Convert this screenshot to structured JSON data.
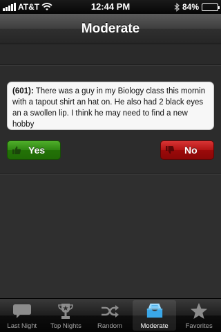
{
  "status_bar": {
    "carrier": "AT&T",
    "time": "12:44 PM",
    "battery": "84%",
    "battery_level": 0.84
  },
  "nav": {
    "title": "Moderate"
  },
  "quote": {
    "id": "(601):",
    "text": "There was a guy in my Biology class this mornin with a tapout shirt an hat on. He also had 2 black eyes an a swollen lip. I think he may need to find a new hobby"
  },
  "buttons": {
    "yes": "Yes",
    "no": "No"
  },
  "colors": {
    "yes": "#2e8612",
    "no": "#b31414",
    "active_tab": "#3aa7e8"
  },
  "tabs": [
    {
      "label": "Last Night",
      "icon": "speech-bubble-icon"
    },
    {
      "label": "Top Nights",
      "icon": "trophy-icon"
    },
    {
      "label": "Random",
      "icon": "shuffle-icon"
    },
    {
      "label": "Moderate",
      "icon": "inbox-icon",
      "active": true
    },
    {
      "label": "Favorites",
      "icon": "star-icon"
    }
  ]
}
